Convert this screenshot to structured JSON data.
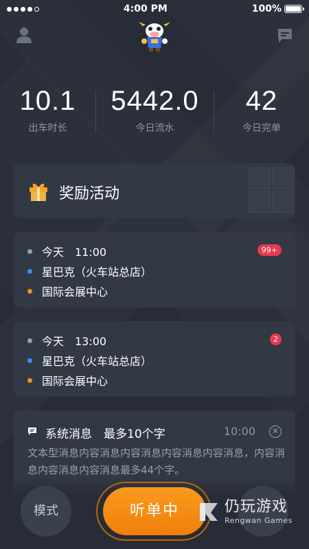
{
  "status_bar": {
    "signal_bars_filled": 4,
    "time": "4:00 PM",
    "battery": "100%"
  },
  "header": {
    "left_icon": "user-icon",
    "center_icon": "mascot-logo",
    "right_icon": "message-icon"
  },
  "stats": [
    {
      "value": "10.1",
      "label": "出车时长"
    },
    {
      "value": "5442.0",
      "label": "今日流水"
    },
    {
      "value": "42",
      "label": "今日完单"
    }
  ],
  "reward": {
    "icon": "gift-icon",
    "title": "奖励活动"
  },
  "orders": [
    {
      "time": "今天　11:00",
      "from": "星巴克（火车站总店）",
      "to": "国际会展中心",
      "badge": "99+"
    },
    {
      "time": "今天　13:00",
      "from": "星巴克（火车站总店）",
      "to": "国际会展中心",
      "badge": "2"
    }
  ],
  "system_message": {
    "icon": "message-icon",
    "title": "系统消息　最多10个字",
    "time": "10:00",
    "body": "文本型消息内容消息内容消息内容消息内容消息，内容消息内容消息内容消息最多44个字。"
  },
  "bottom": {
    "mode_label": "模式",
    "listen_label": "听单中"
  },
  "watermark": {
    "cn": "仍玩游戏",
    "en": "Rengwan Games"
  },
  "colors": {
    "background": "#272c36",
    "card": "#323844",
    "accent_orange": "#f39018",
    "badge_red": "#e8394d",
    "dot_blue": "#3e8ef7"
  }
}
